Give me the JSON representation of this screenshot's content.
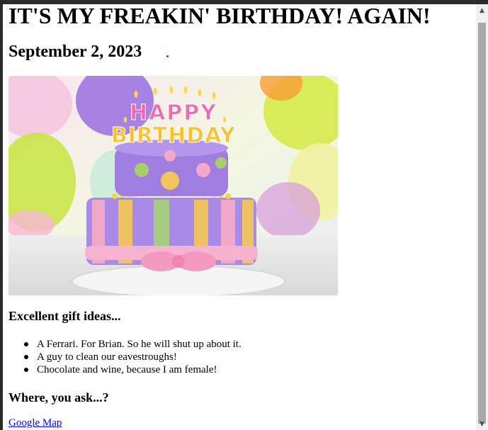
{
  "page": {
    "title": "IT'S MY FREAKIN' BIRTHDAY! AGAIN!",
    "date": "September 2, 2023"
  },
  "image": {
    "alt": "Birthday cake",
    "topper_line1": "HAPPY",
    "topper_line2": "BIRTHDAY",
    "letter_colors": [
      "#f06ab0",
      "#fbc02d",
      "#2fbf71",
      "#4aa3f0",
      "#f0624d",
      "#a56cf0",
      "#ffb52e"
    ]
  },
  "gifts": {
    "heading": "Excellent gift ideas...",
    "items": [
      "A Ferrari. For Brian. So he will shut up about it.",
      "A guy to clean our eavestroughs!",
      "Chocolate and wine, because I am female!"
    ]
  },
  "location": {
    "heading": "Where, you ask...?",
    "link_text": "Google Map"
  },
  "colors": {
    "link": "#0000ee",
    "chrome": "#2b2b2b",
    "scrollbar_track": "#f0f0f0",
    "scrollbar_thumb": "#a8a8a8"
  }
}
